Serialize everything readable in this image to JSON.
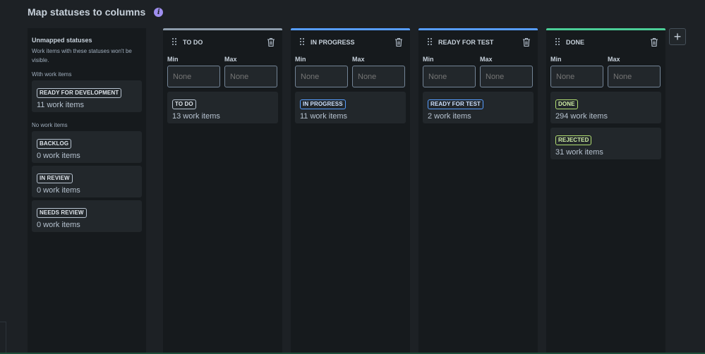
{
  "header": {
    "title": "Map statuses to columns",
    "info_icon": "info-icon"
  },
  "unmapped": {
    "title": "Unmapped statuses",
    "description": "Work items with these statuses won't be visible.",
    "with_items_label": "With work items",
    "with_items": [
      {
        "status": "READY FOR DEVELOPMENT",
        "count": "11 work items"
      }
    ],
    "no_items_label": "No work items",
    "no_items": [
      {
        "status": "BACKLOG",
        "count": "0 work items"
      },
      {
        "status": "IN REVIEW",
        "count": "0 work items"
      },
      {
        "status": "NEEDS REVIEW",
        "count": "0 work items"
      }
    ]
  },
  "columns": [
    {
      "title": "TO DO",
      "color": "#8c9bab",
      "min_label": "Min",
      "max_label": "Max",
      "min_placeholder": "None",
      "max_placeholder": "None",
      "cards": [
        {
          "status": "TO DO",
          "count": "13 work items",
          "tone": "neutral"
        }
      ]
    },
    {
      "title": "IN PROGRESS",
      "color": "#579dff",
      "min_label": "Min",
      "max_label": "Max",
      "min_placeholder": "None",
      "max_placeholder": "None",
      "cards": [
        {
          "status": "IN PROGRESS",
          "count": "11 work items",
          "tone": "blue"
        }
      ]
    },
    {
      "title": "READY FOR TEST",
      "color": "#579dff",
      "min_label": "Min",
      "max_label": "Max",
      "min_placeholder": "None",
      "max_placeholder": "None",
      "cards": [
        {
          "status": "READY FOR TEST",
          "count": "2 work items",
          "tone": "blue"
        }
      ]
    },
    {
      "title": "DONE",
      "color": "#4bce97",
      "min_label": "Min",
      "max_label": "Max",
      "min_placeholder": "None",
      "max_placeholder": "None",
      "cards": [
        {
          "status": "DONE",
          "count": "294 work items",
          "tone": "lime"
        },
        {
          "status": "REJECTED",
          "count": "31 work items",
          "tone": "lime"
        }
      ]
    }
  ],
  "add_column": {
    "label": "+",
    "icon": "plus-icon"
  },
  "icons": {
    "drag": "drag-handle-icon",
    "delete": "trash-icon"
  }
}
